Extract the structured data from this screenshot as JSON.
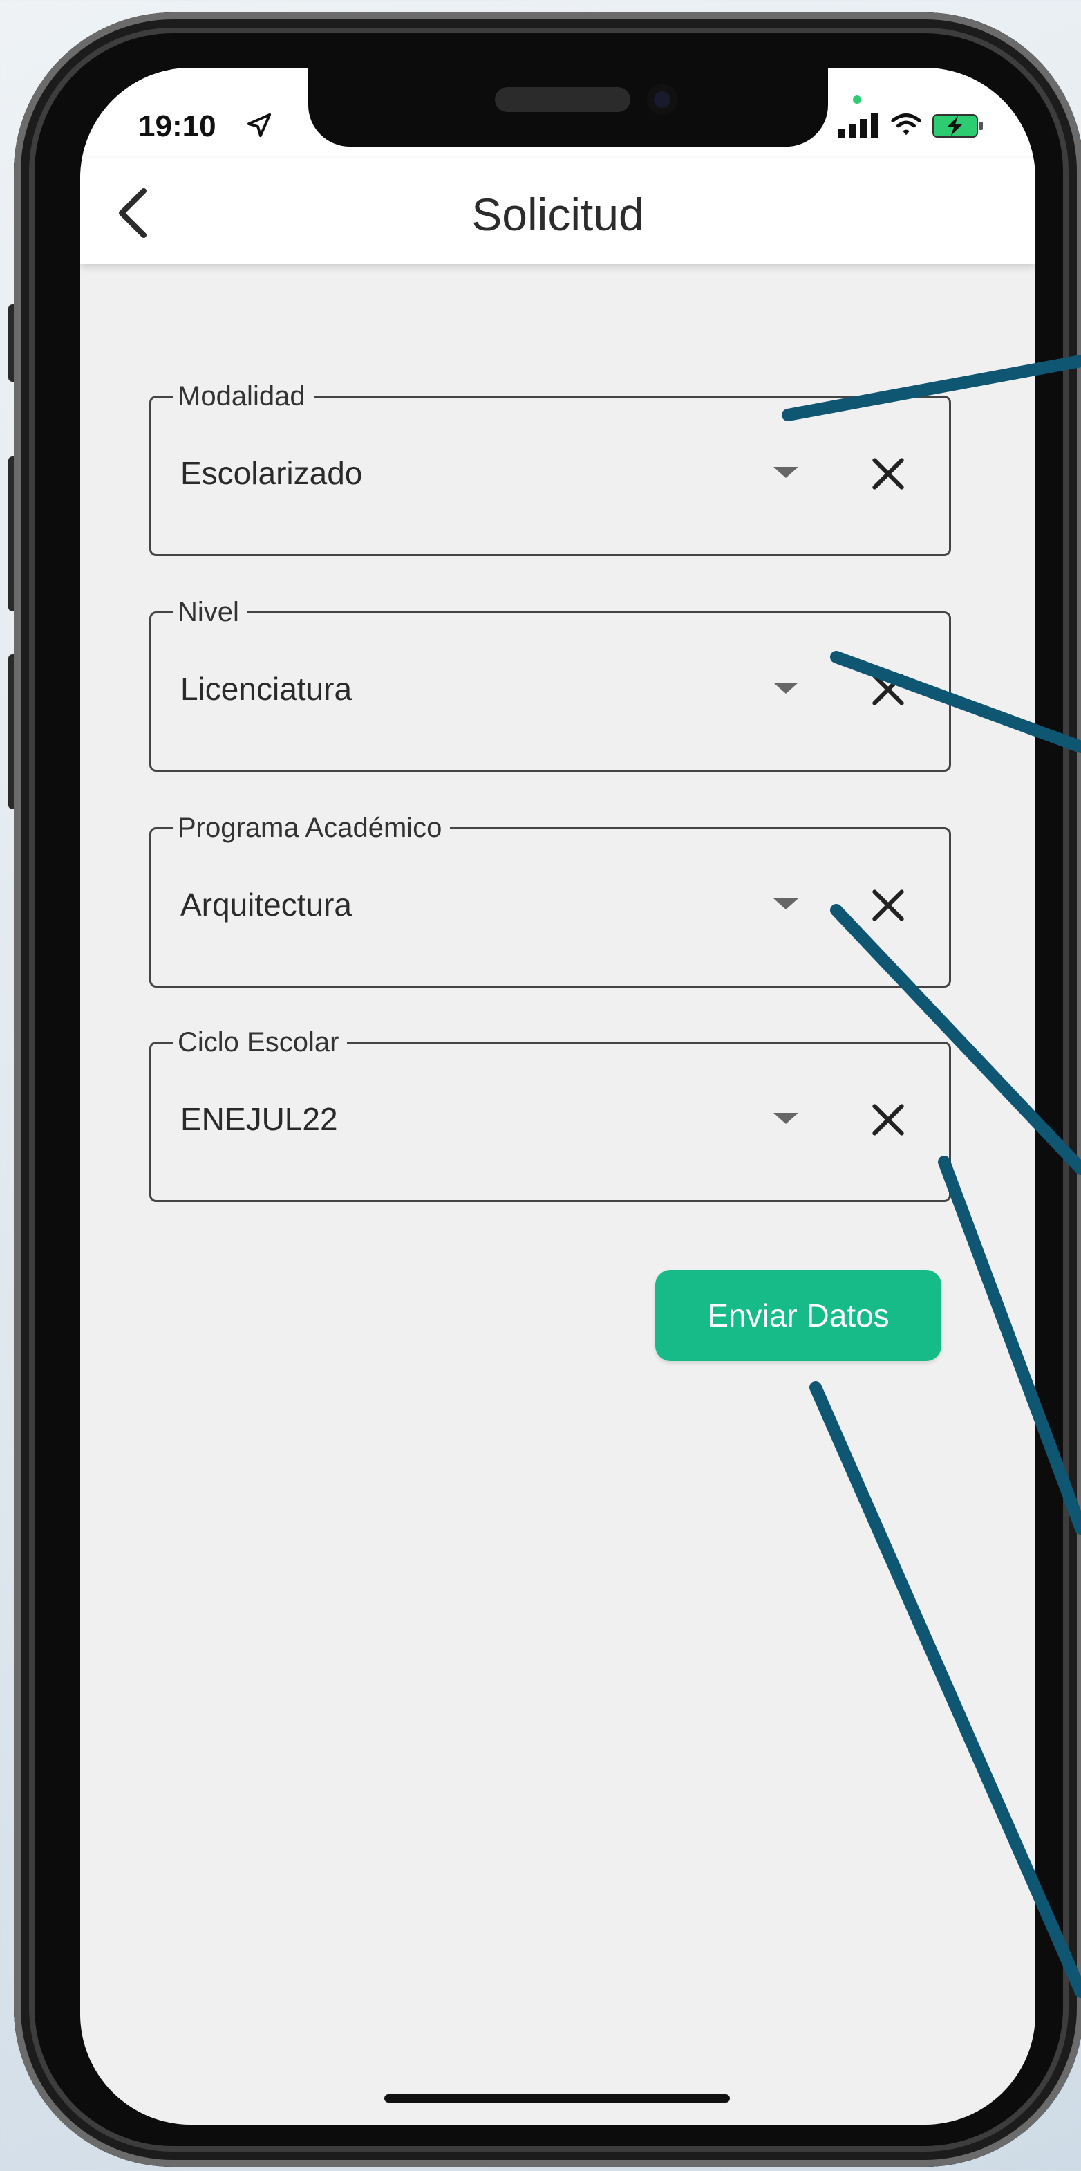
{
  "status_bar": {
    "time": "19:10"
  },
  "app_bar": {
    "title": "Solicitud"
  },
  "form": {
    "fields": [
      {
        "label": "Modalidad",
        "value": "Escolarizado"
      },
      {
        "label": "Nivel",
        "value": "Licenciatura"
      },
      {
        "label": "Programa Académico",
        "value": "Arquitectura"
      },
      {
        "label": "Ciclo Escolar",
        "value": "ENEJUL22"
      }
    ],
    "submit_label": "Enviar Datos"
  },
  "colors": {
    "accent": "#17bb87",
    "callout": "#0f5673",
    "background": "#f0f0f0"
  },
  "icons": [
    "location-arrow-icon",
    "signal-icon",
    "wifi-icon",
    "battery-charging-icon",
    "back-chevron-icon",
    "dropdown-caret-icon",
    "clear-icon"
  ]
}
